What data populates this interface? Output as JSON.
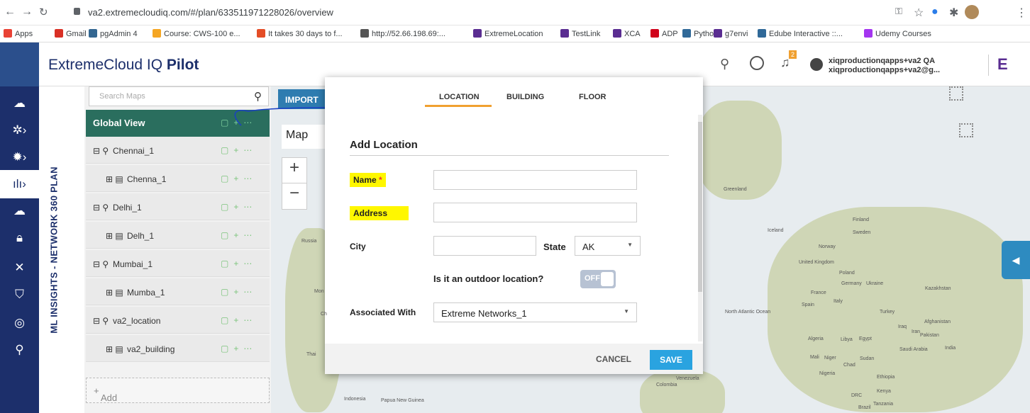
{
  "browser": {
    "url": "va2.extremecloudiq.com/#/plan/633511971228026/overview"
  },
  "bookmarks": [
    {
      "label": "Apps",
      "color": "#e94235"
    },
    {
      "label": "Gmail",
      "color": "#d93025"
    },
    {
      "label": "pgAdmin 4",
      "color": "#336791"
    },
    {
      "label": "Course: CWS-100 e...",
      "color": "#f5a623"
    },
    {
      "label": "It takes 30 days to f...",
      "color": "#e44d26"
    },
    {
      "label": "http://52.66.198.69:...",
      "color": "#555555"
    },
    {
      "label": "ExtremeLocation",
      "color": "#5a2d91"
    },
    {
      "label": "TestLink",
      "color": "#5a2d91"
    },
    {
      "label": "XCA",
      "color": "#5a2d91"
    },
    {
      "label": "ADP",
      "color": "#d0021b"
    },
    {
      "label": "Python",
      "color": "#306998"
    },
    {
      "label": "g7envi",
      "color": "#5a2d91"
    },
    {
      "label": "Edube Interactive ::...",
      "color": "#306998"
    },
    {
      "label": "Udemy Courses",
      "color": "#a435f0"
    }
  ],
  "header": {
    "title_prefix": "ExtremeCloud IQ ",
    "title_bold": "Pilot",
    "user_name": "xiqproductionqapps+va2 QA",
    "user_email": "xiqproductionqapps+va2@g...",
    "notif_count": "2"
  },
  "sidebar": {
    "vertical_label": "ML INSIGHTS - NETWORK 360 PLAN",
    "search_placeholder": "Search Maps",
    "global_view": "Global View",
    "nodes": [
      {
        "label": "Chennai_1"
      },
      {
        "label": "Chenna_1"
      },
      {
        "label": "Delhi_1"
      },
      {
        "label": "Delh_1"
      },
      {
        "label": "Mumbai_1"
      },
      {
        "label": "Mumba_1"
      },
      {
        "label": "va2_location"
      },
      {
        "label": "va2_building"
      }
    ],
    "add_label": "Add"
  },
  "map": {
    "import_label": "IMPORT",
    "map_tab": "Map",
    "zoom_in": "+",
    "zoom_out": "−",
    "labels": [
      "Greenland",
      "Iceland",
      "Finland",
      "Sweden",
      "Norway",
      "United Kingdom",
      "Poland",
      "Germany",
      "Ukraine",
      "France",
      "Kazakhstan",
      "Spain",
      "Italy",
      "Turkey",
      "Afghanistan",
      "Iraq",
      "Iran",
      "Pakistan",
      "India",
      "Algeria",
      "Libya",
      "Egypt",
      "Saudi Arabia",
      "Mali",
      "Niger",
      "Chad",
      "Sudan",
      "Nigeria",
      "Ethiopia",
      "Kenya",
      "DRC",
      "Tanzania",
      "Colombia",
      "Brazil",
      "Venezuela",
      "Indonesia",
      "Papua New Guinea",
      "Thai",
      "North Atlantic Ocean",
      "Russia",
      "Mon",
      "Ch"
    ]
  },
  "modal": {
    "tabs": [
      "LOCATION",
      "BUILDING",
      "FLOOR"
    ],
    "heading": "Add Location",
    "fields": {
      "name": "Name",
      "required": "*",
      "address": "Address",
      "city": "City",
      "state": "State",
      "state_value": "AK",
      "outdoor_q": "Is it an outdoor location?",
      "toggle": "OFF",
      "associated": "Associated With",
      "associated_value": "Extreme Networks_1"
    },
    "cancel": "CANCEL",
    "save": "SAVE"
  }
}
